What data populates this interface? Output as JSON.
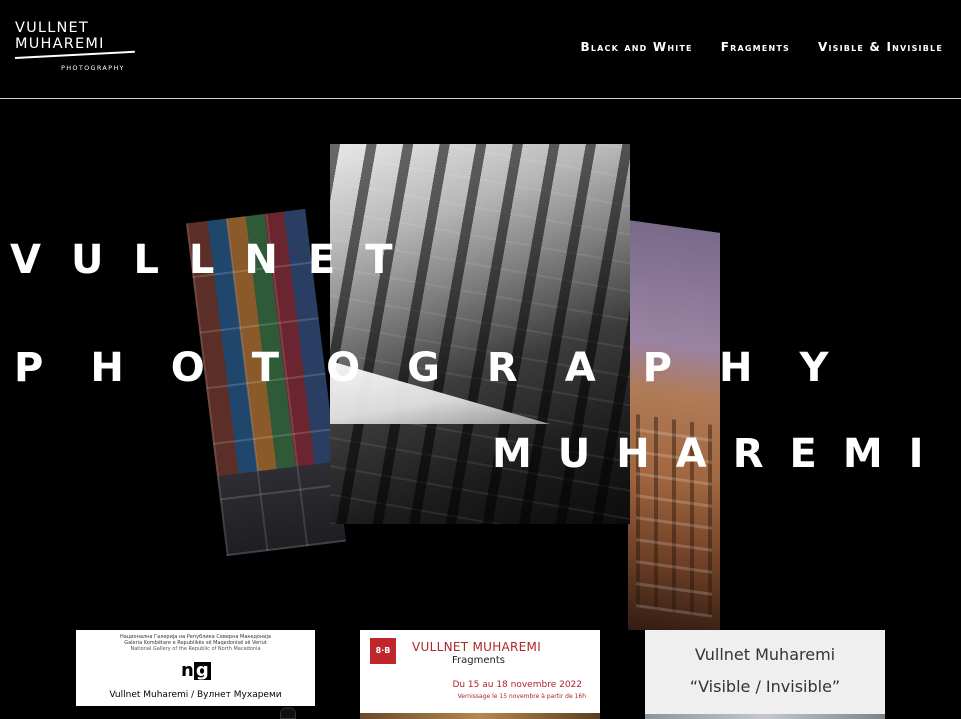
{
  "header": {
    "logo": {
      "line1": "VULLNET",
      "line2": "MUHAREMI",
      "sub": "PHOTOGRAPHY"
    },
    "nav": [
      {
        "label": "Black and White"
      },
      {
        "label": "Fragments"
      },
      {
        "label": "Visible & Invisible"
      }
    ]
  },
  "hero": {
    "word1": "VULLNET",
    "word2": "PHOTOGRAPHY",
    "word3": "MUHAREMI"
  },
  "cards": [
    {
      "line1": "Национална Галерија на Република Северна Македонија",
      "line2": "Galeria Kombëtare e Republikës së Maqedonisë së Veriut",
      "line3": "National Gallery of the Republic of North Macedonia",
      "logo_text": "n",
      "logo_box": "g",
      "name": "Vullnet Muharemi / Вулнет Мухареми"
    },
    {
      "badge": "8·B",
      "title": "VULLNET MUHAREMI",
      "subtitle": "Fragments",
      "dates": "Du 15 au 18 novembre 2022",
      "vernissage": "Vernissage le 15 novembre à partir de 16h"
    },
    {
      "title": "Vullnet Muharemi",
      "subtitle": "“Visible / Invisible”"
    }
  ],
  "colors": {
    "background": "#000000",
    "text": "#ffffff",
    "accent_red": "#b0242a"
  }
}
